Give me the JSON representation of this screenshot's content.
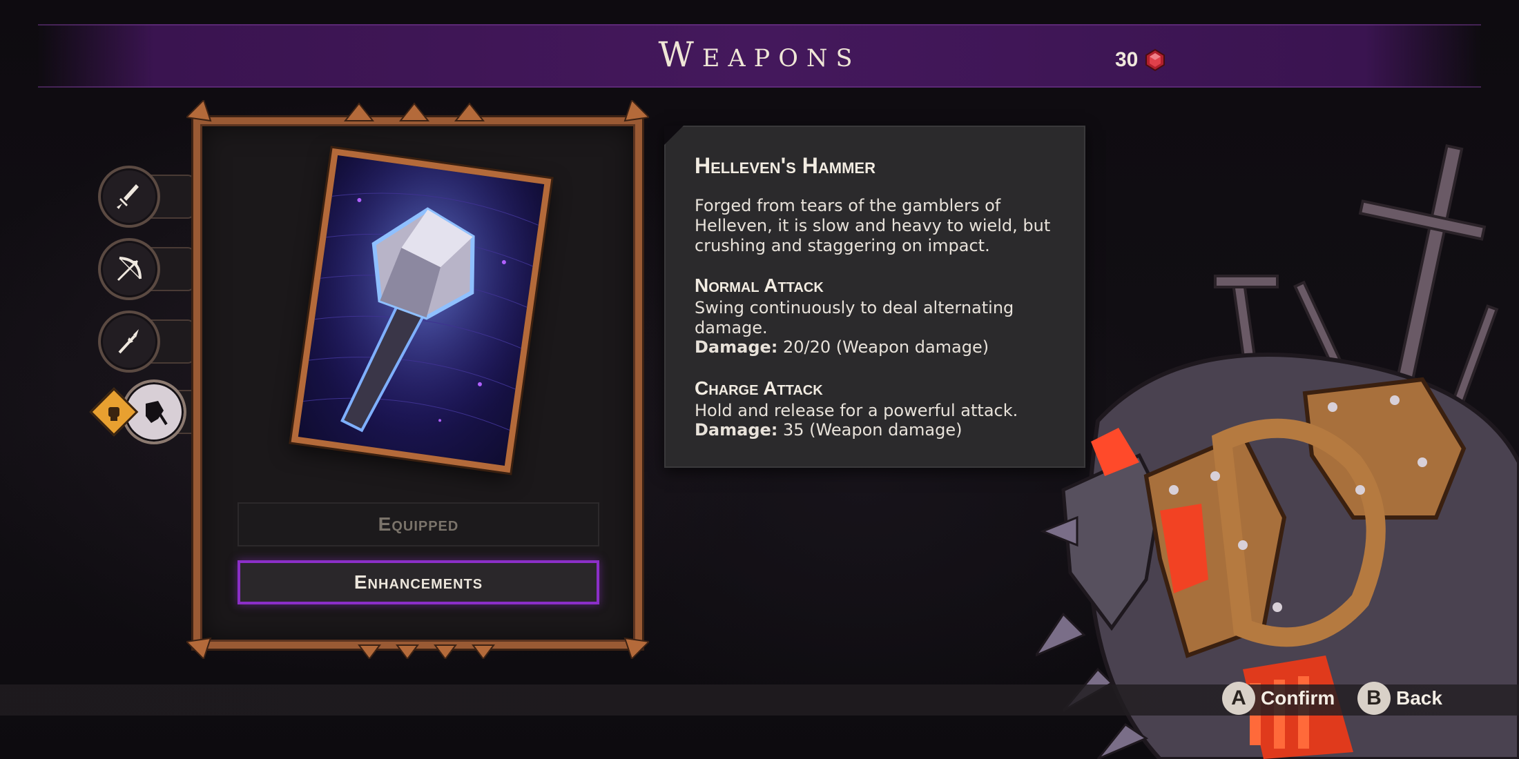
{
  "header": {
    "title": "Weapons",
    "currency_value": "30",
    "currency_icon": "red-gem-icon"
  },
  "tabs": [
    {
      "name": "sword",
      "icon": "sword-icon"
    },
    {
      "name": "bow",
      "icon": "bow-icon"
    },
    {
      "name": "spear",
      "icon": "spear-icon"
    },
    {
      "name": "hammer",
      "icon": "hammer-icon",
      "active": true
    }
  ],
  "tab_badge_icon": "fist-icon",
  "weapon": {
    "name": "Helleven's Hammer",
    "description": "Forged from tears of the gamblers of Helleven, it is slow and heavy to wield, but crushing and staggering on impact.",
    "normal_attack": {
      "title": "Normal Attack",
      "description": "Swing continuously to deal alternating damage.",
      "damage_label": "Damage:",
      "damage_value": "20/20 (Weapon damage)"
    },
    "charge_attack": {
      "title": "Charge Attack",
      "description": "Hold and release for a powerful attack.",
      "damage_label": "Damage:",
      "damage_value": "35 (Weapon damage)"
    }
  },
  "buttons": {
    "equipped": "Equipped",
    "enhancements": "Enhancements"
  },
  "controls": [
    {
      "key": "A",
      "label": "Confirm"
    },
    {
      "key": "B",
      "label": "Back"
    }
  ],
  "colors": {
    "accent": "#8b2fc7",
    "frame": "#9a5a34",
    "banner": "#44185c",
    "currency": "#c0303a"
  }
}
